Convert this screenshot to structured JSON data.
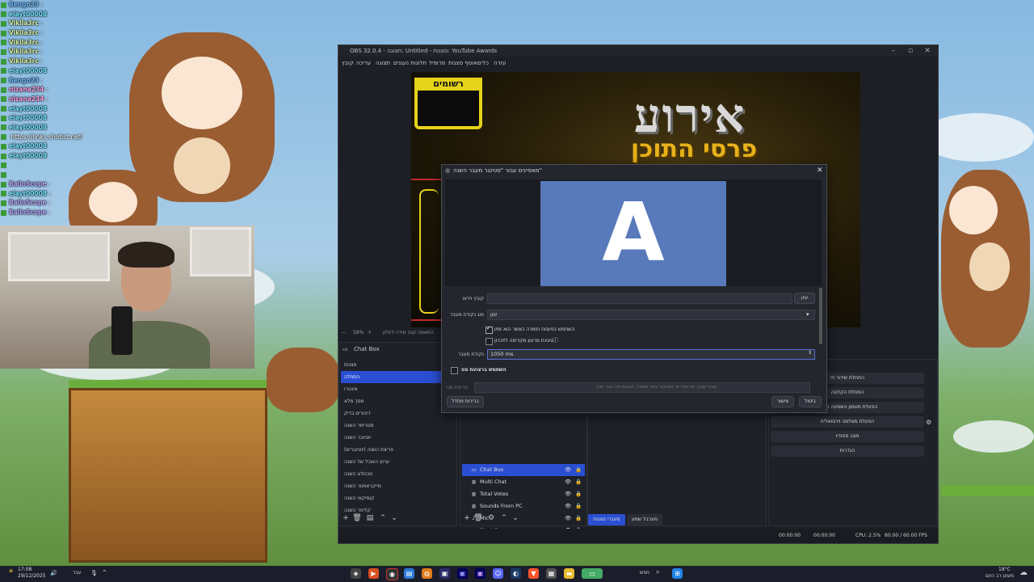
{
  "chat": {
    "lines": [
      {
        "name": "Bengo23",
        "msg": ":",
        "color": "#6fb8ff"
      },
      {
        "name": "elayt00008",
        "msg": "",
        "color": "#6fe3ff"
      },
      {
        "name": "Vikila3rc",
        "msg": ":",
        "color": "#d9f0a0"
      },
      {
        "name": "Vikila3rc",
        "msg": ":",
        "color": "#d9f0a0"
      },
      {
        "name": "Vikila3rc",
        "msg": ":",
        "color": "#d9f0a0"
      },
      {
        "name": "Vikila3rc",
        "msg": ":",
        "color": "#d9f0a0"
      },
      {
        "name": "Vikila3rc",
        "msg": ":",
        "color": "#d9f0a0"
      },
      {
        "name": "elayt00008",
        "msg": "",
        "color": "#6fe3ff"
      },
      {
        "name": "Bengo23",
        "msg": ":",
        "color": "#6fb8ff"
      },
      {
        "name": "nizana234",
        "msg": ":",
        "color": "#ff9de0"
      },
      {
        "name": "nizana234",
        "msg": ":",
        "color": "#ff9de0"
      },
      {
        "name": "elayt00008",
        "msg": "",
        "color": "#6fe3ff"
      },
      {
        "name": "elayt00008",
        "msg": "",
        "color": "#6fe3ff"
      },
      {
        "name": "elayt00008",
        "msg": "",
        "color": "#6fe3ff"
      },
      {
        "name": "",
        "msg": "https://links.shotist.net/",
        "color": "#6fe3ff"
      },
      {
        "name": "elayt00008",
        "msg": "",
        "color": "#6fe3ff"
      },
      {
        "name": "elayt00008",
        "msg": "",
        "color": "#6fe3ff"
      },
      {
        "name": "",
        "msg": "",
        "color": "#6fe3ff"
      },
      {
        "name": "",
        "msg": "",
        "color": "#6fe3ff"
      },
      {
        "name": "BalloScope",
        "msg": ":",
        "color": "#b9a6ff"
      },
      {
        "name": "elayt00008",
        "msg": ":",
        "color": "#6fe3ff"
      },
      {
        "name": "BalloScope",
        "msg": ":",
        "color": "#b9a6ff"
      },
      {
        "name": "BalloScope",
        "msg": ":",
        "color": "#b9a6ff"
      }
    ]
  },
  "obs": {
    "title": "OBS 32.0.4 - תצוגה: Untitled - סצנות: YouTube Awards",
    "menu": [
      "קובץ",
      "עריכה",
      "תצוגה",
      "חלונות נעגנים",
      "פרופיל",
      "אוסף סצנות",
      "כלים",
      "עזרה"
    ],
    "preview": {
      "rec_label": "רשומים",
      "title": "אירוע",
      "subtitle": "פרסי התוכן"
    },
    "preview_status": {
      "zoom": "58%",
      "text": "התאמה קנה מידה לחלון"
    },
    "scenes_dock": {
      "title": "Chat Box",
      "items": [
        "סצנות",
        "התחלה",
        "אינטרו",
        "מסך מלא",
        "דיבורים בדיק",
        "סטרימר השנה",
        "יוטיובר השנה",
        "פריצת השנה (יוטיוברים)",
        "ערוץ האוכל של השנה",
        "טכנולוג השנה",
        "מייקראפטר השנה",
        "קומיקאי השנה",
        "קליפר השנה"
      ],
      "active_index": 1
    },
    "sources": [
      {
        "name": "Chat Box",
        "icon": "▭",
        "active": true
      },
      {
        "name": "Multi Chat",
        "icon": "◍"
      },
      {
        "name": "Total Votes",
        "icon": "◍"
      },
      {
        "name": "Sounds From PC",
        "icon": "◍"
      },
      {
        "name": "Mic",
        "icon": "♪"
      },
      {
        "name": "Start Screen",
        "icon": "▶"
      }
    ],
    "mixer_tabs": {
      "tab1": "מעברי סצנות",
      "tab2": "מערבל שמע"
    },
    "controls": [
      "התחלת שידור חי",
      "התחלת הקלטה",
      "הפעלת מטמון השמעה חוזרת",
      "הפעלת מצלמה וירטואלית",
      "מצב סטודיו",
      "הגדרות"
    ],
    "status": {
      "time1": "00:00:00",
      "time2": "00:00:00",
      "cpu": "CPU: 2.5%",
      "fps": "60.00 / 60.00 FPS"
    }
  },
  "dialog": {
    "title": "מאפיינים עבור \"סטינגר מעבר השנה\"",
    "preview_letter": "A",
    "video_file_label": "קובץ וידאו",
    "browse_label": "עיון",
    "transition_point_type_label": "סוג נקודת מעבר",
    "transition_point_type_value": "זמן",
    "check1_label": "השתמש בפענוח חומרה כאשר הוא זמין",
    "check1_checked": true,
    "check2_label": "טעינת סרטון מקדימה לזיכרון",
    "check2_checked": false,
    "transition_point_label": "נקודת מעבר",
    "transition_point_value": "1050 ms",
    "track_matte_label": "השתמש ברצועת מט",
    "matte_layout_label": "פריסת מט",
    "matte_layout_value": "אותו קובץ, זה-בצד-זה (סטינגר בצד שמאל, רצועת מט בצד ימין)",
    "defaults_button": "ברירות מחדל",
    "ok_button": "אישור",
    "cancel_button": "ביטול"
  },
  "taskbar": {
    "time": "17:08",
    "date": "29/12/2025",
    "language": "עבר",
    "search_label": "חפש",
    "weather_temp": "18°C",
    "weather_desc": "מעונן רב היום"
  }
}
